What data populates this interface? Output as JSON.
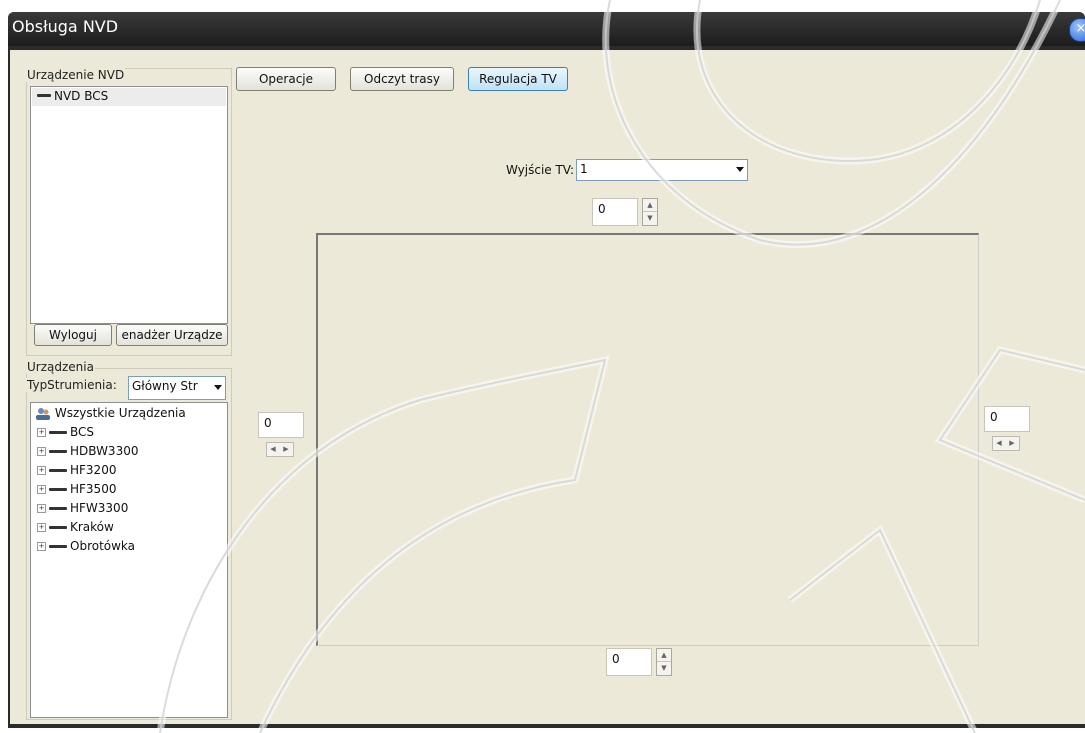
{
  "window": {
    "title": "Obsługa NVD"
  },
  "nvd_group": {
    "label": "Urządzenie NVD",
    "items": [
      {
        "label": "NVD BCS"
      }
    ],
    "logout_label": "Wyloguj",
    "manager_label": "enadżer Urządze"
  },
  "devices_group": {
    "label": "Urządzenia",
    "stream_type_label": "TypStrumienia:",
    "stream_type_value": "Główny Str",
    "tree_root": "Wszystkie Urządzenia",
    "tree_items": [
      {
        "label": "BCS"
      },
      {
        "label": "HDBW3300"
      },
      {
        "label": "HF3200"
      },
      {
        "label": "HF3500"
      },
      {
        "label": "HFW3300"
      },
      {
        "label": "Kraków"
      },
      {
        "label": "Obrotówka"
      }
    ]
  },
  "tabs": [
    {
      "label": "Operacje"
    },
    {
      "label": "Odczyt trasy"
    },
    {
      "label": "Regulacja TV"
    }
  ],
  "tv_output": {
    "label": "Wyjście TV:",
    "value": "1"
  },
  "margins": {
    "top": "0",
    "left": "0",
    "right": "0",
    "bottom": "0"
  },
  "icons": {
    "close": "close-icon",
    "user": "users-icon",
    "device": "device-icon",
    "expand": "plus-icon"
  },
  "colors": {
    "window_bg": "#ece9d8",
    "titlebar": "#2b2b2b",
    "active_tab": "#bfe2f7"
  }
}
